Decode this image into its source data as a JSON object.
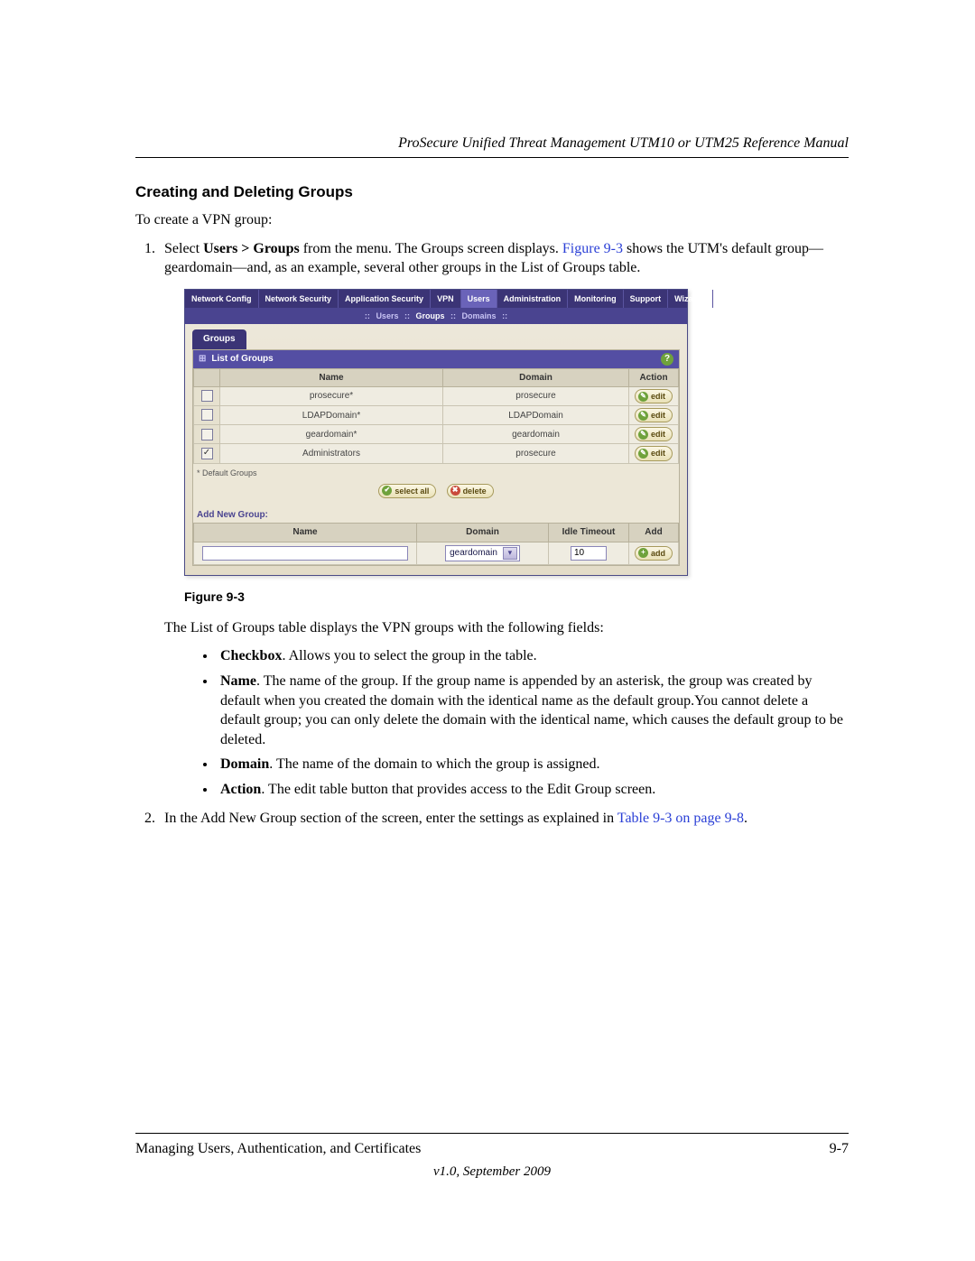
{
  "doc": {
    "running_head": "ProSecure Unified Threat Management UTM10 or UTM25 Reference Manual",
    "section_title": "Creating and Deleting Groups",
    "intro": "To create a VPN group:",
    "step1_pre": "Select ",
    "step1_bold": "Users > Groups",
    "step1_mid": " from the menu. The Groups screen displays. ",
    "step1_link": "Figure 9-3",
    "step1_post": " shows the UTM's default group—geardomain—and, as an example, several other groups in the List of Groups table.",
    "fig_caption": "Figure 9-3",
    "after_fig": "The List of Groups table displays the VPN groups with the following fields:",
    "bullets": {
      "b1_bold": "Checkbox",
      "b1_rest": ". Allows you to select the group in the table.",
      "b2_bold": "Name",
      "b2_rest": ". The name of the group. If the group name is appended by an asterisk, the group was created by default when you created the domain with the identical name as the default group.You cannot delete a default group; you can only delete the domain with the identical name, which causes the default group to be deleted.",
      "b3_bold": "Domain",
      "b3_rest": ". The name of the domain to which the group is assigned.",
      "b4_bold": "Action",
      "b4_rest": ". The edit table button that provides access to the Edit Group screen."
    },
    "step2_pre": "In the Add New Group section of the screen, enter the settings as explained in ",
    "step2_link": "Table 9-3 on page 9-8",
    "step2_post": ".",
    "footer_left": "Managing Users, Authentication, and Certificates",
    "footer_right": "9-7",
    "footer_center": "v1.0, September 2009"
  },
  "ui": {
    "main_tabs": [
      "Network Config",
      "Network Security",
      "Application Security",
      "VPN",
      "Users",
      "Administration",
      "Monitoring",
      "Support",
      "Wizards"
    ],
    "main_tab_active_index": 4,
    "sub_nav": {
      "items": [
        "Users",
        "Groups",
        "Domains"
      ],
      "active_index": 1,
      "sep": "::"
    },
    "sub_tab": "Groups",
    "panel_title": "List of Groups",
    "help_icon": "?",
    "columns": {
      "checkbox": "",
      "name": "Name",
      "domain": "Domain",
      "action": "Action"
    },
    "rows": [
      {
        "checked": false,
        "name": "prosecure*",
        "domain": "prosecure",
        "action": "edit"
      },
      {
        "checked": false,
        "name": "LDAPDomain*",
        "domain": "LDAPDomain",
        "action": "edit"
      },
      {
        "checked": false,
        "name": "geardomain*",
        "domain": "geardomain",
        "action": "edit"
      },
      {
        "checked": true,
        "name": "Administrators",
        "domain": "prosecure",
        "action": "edit"
      }
    ],
    "footnote": "* Default Groups",
    "btn_select_all": "select all",
    "btn_delete": "delete",
    "add_section_title": "Add New Group:",
    "add_columns": {
      "name": "Name",
      "domain": "Domain",
      "idle": "Idle Timeout",
      "add": "Add"
    },
    "add_row": {
      "name_value": "",
      "domain_selected": "geardomain",
      "idle_value": "10",
      "add_btn": "add"
    }
  }
}
